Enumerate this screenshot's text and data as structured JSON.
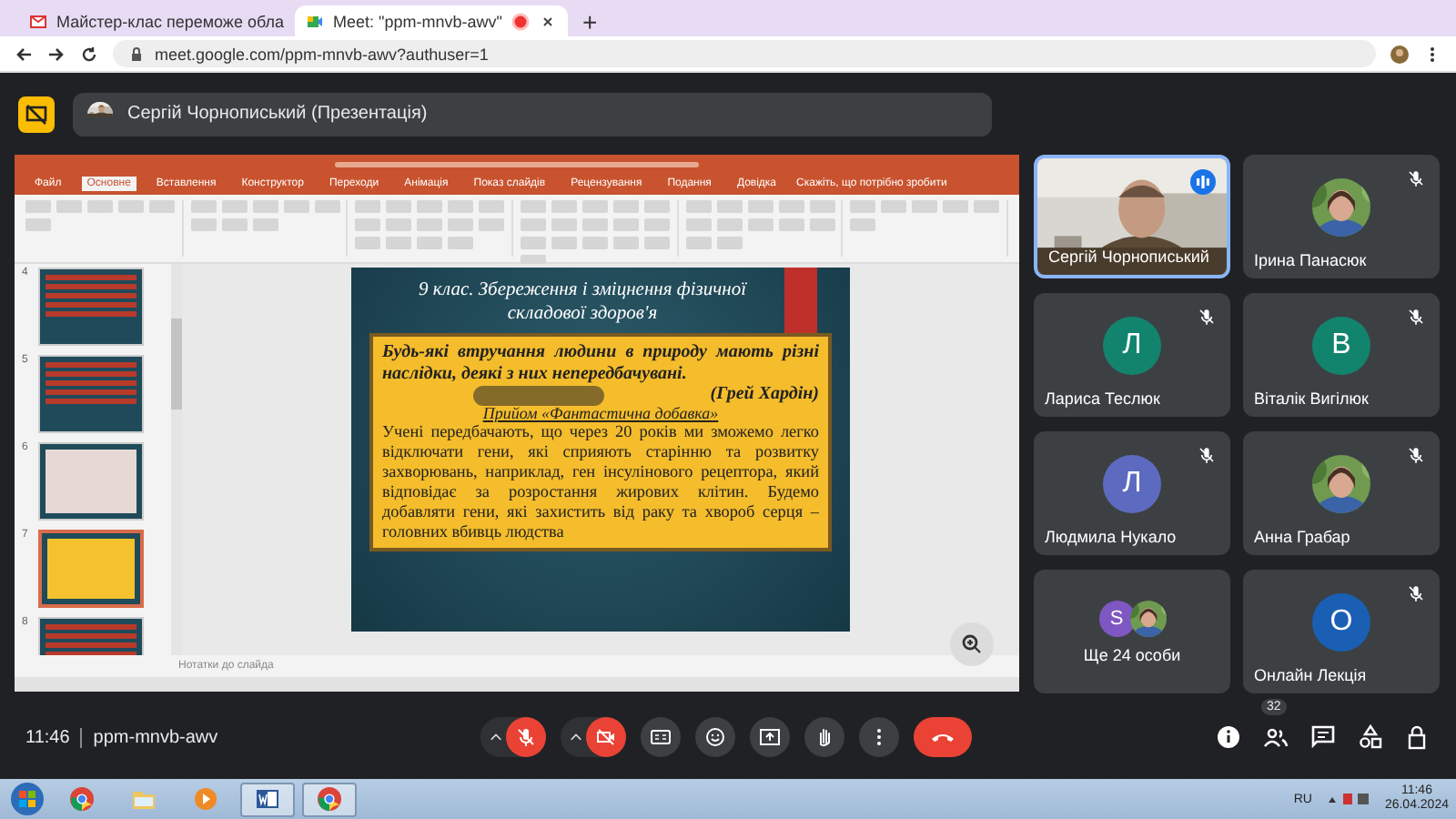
{
  "browser": {
    "tabs": [
      {
        "title": "Майстер-клас переможе обла",
        "kind": "mail",
        "selected": false
      },
      {
        "title": "Meet: \"ppm-mnvb-awv\"",
        "kind": "meet",
        "selected": true,
        "recording": true
      }
    ],
    "new_tab": "+",
    "url": "meet.google.com/ppm-mnvb-awv?authuser=1"
  },
  "header": {
    "presenter": "Сергій Чорнописький (Презентація)"
  },
  "presentation": {
    "ribbon_tabs": [
      {
        "label": "Файл",
        "selected": false
      },
      {
        "label": "Основне",
        "selected": true
      },
      {
        "label": "Вставлення",
        "selected": false
      },
      {
        "label": "Конструктор",
        "selected": false
      },
      {
        "label": "Переходи",
        "selected": false
      },
      {
        "label": "Анімація",
        "selected": false
      },
      {
        "label": "Показ слайдів",
        "selected": false
      },
      {
        "label": "Рецензування",
        "selected": false
      },
      {
        "label": "Подання",
        "selected": false
      },
      {
        "label": "Довідка",
        "selected": false
      }
    ],
    "tell_me": "Скажіть, що потрібно зробити",
    "thumbnails": [
      {
        "number": "4",
        "kind": "list",
        "selected": false
      },
      {
        "number": "5",
        "kind": "list",
        "selected": false
      },
      {
        "number": "6",
        "kind": "table",
        "selected": false
      },
      {
        "number": "7",
        "kind": "text",
        "selected": true
      },
      {
        "number": "8",
        "kind": "list",
        "selected": false
      }
    ],
    "slide": {
      "title": "9 клас. Збереження і зміцнення фізичної складової здоров'я",
      "quote": "Будь-які втручання людини в природу мають різні наслідки, деякі з них непередбачувані.",
      "author": "(Грей Хардін)",
      "heading": "Прийом «Фантастична добавка»",
      "body": "Учені передбачають, що через 20 років ми зможемо легко відключати гени, які сприяють старінню та розвитку захворювань, наприклад, ген інсулінового рецептора, який відповідає за розростання жирових клітин. Будемо добавляти гени, які захистить від раку та хвороб серця – головних вбивць людства"
    },
    "notes": "Нотатки до слайда"
  },
  "participants": [
    {
      "name": "Сергій Чорнописький",
      "kind": "video",
      "muted": false
    },
    {
      "name": "Ірина Панасюк",
      "muted": true
    },
    {
      "name": "Лариса Теслюк",
      "kind": "initial",
      "initial": "Л",
      "color": "#12846e",
      "muted": true
    },
    {
      "name": "Віталік Вигілюк",
      "kind": "initial",
      "initial": "В",
      "color": "#12846e",
      "muted": true
    },
    {
      "name": "Людмила Нукало",
      "kind": "initial",
      "initial": "Л",
      "color": "#5c6bc0",
      "muted": true
    },
    {
      "name": "Анна Грабар",
      "muted": true
    },
    {
      "name": "Ще 24 особи",
      "kind": "more",
      "initial": "S",
      "color": "#7e57c2",
      "muted": false
    },
    {
      "name": "Онлайн Лекція",
      "kind": "initial",
      "initial": "О",
      "color": "#1a5fb4",
      "muted": true
    }
  ],
  "meeting": {
    "time": "11:46",
    "code": "ppm-mnvb-awv",
    "mic_on": false,
    "camera_on": false,
    "people_count": "32"
  },
  "taskbar": {
    "apps": [
      {
        "kind": "chrome",
        "active": false
      },
      {
        "kind": "folder",
        "active": false
      },
      {
        "kind": "media",
        "active": false
      },
      {
        "kind": "word",
        "active": true
      },
      {
        "kind": "chrome",
        "active": true
      }
    ],
    "language": "RU",
    "time": "11:46",
    "date": "26.04.2024"
  }
}
